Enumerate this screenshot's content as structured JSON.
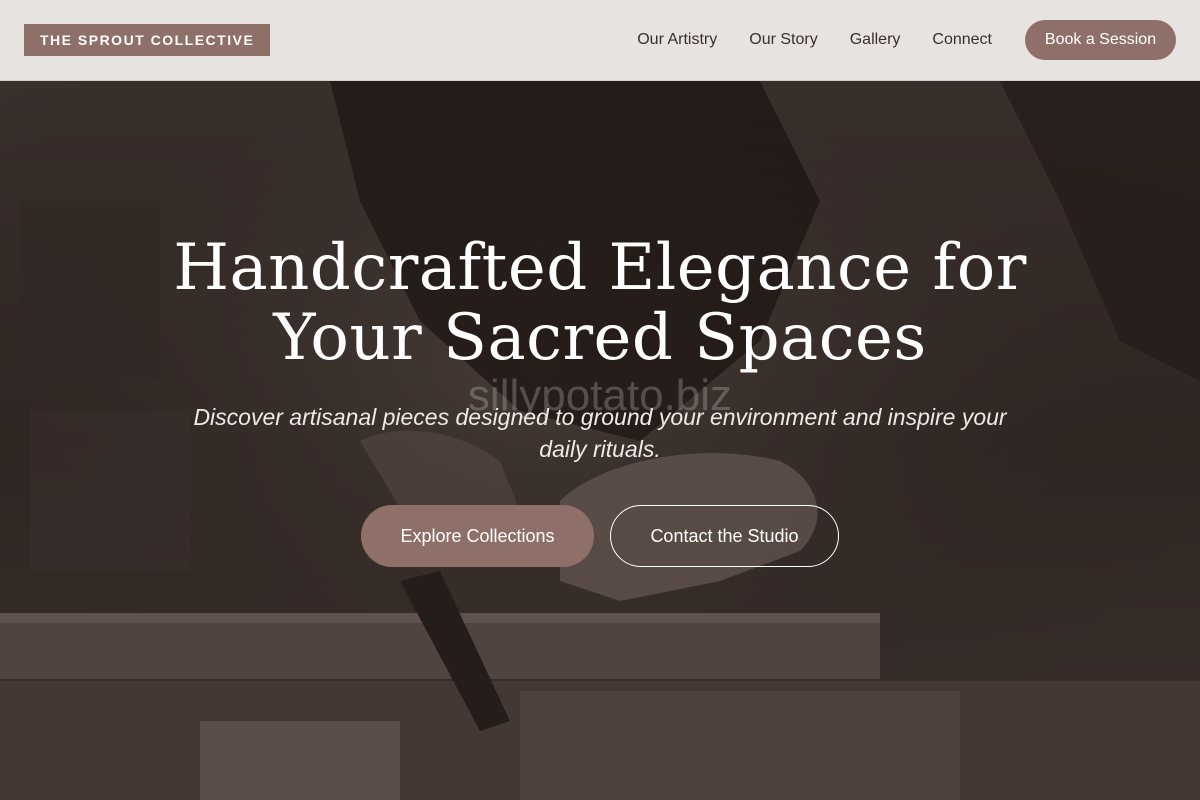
{
  "brand": {
    "logo_text": "THE SPROUT COLLECTIVE",
    "accent_color": "#8f7069",
    "header_bg": "#e7e3e0"
  },
  "nav": {
    "links": [
      "Our Artistry",
      "Our Story",
      "Gallery",
      "Connect"
    ],
    "cta_label": "Book a Session"
  },
  "hero": {
    "title_line1": "Handcrafted Elegance for",
    "title_line2": "Your Sacred Spaces",
    "watermark": "sillypotato.biz",
    "subtitle": "Discover artisanal pieces designed to ground your environment and inspire your daily rituals.",
    "primary_button": "Explore Collections",
    "secondary_button": "Contact the Studio",
    "background_image": "craftsman-hands-woodworking-photo"
  }
}
